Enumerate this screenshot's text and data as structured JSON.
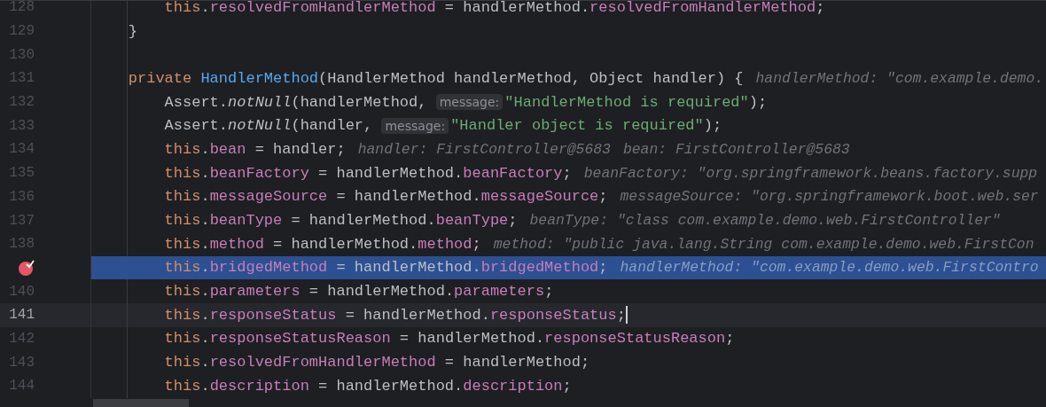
{
  "editor": {
    "lines": [
      {
        "number": "128",
        "current": false,
        "selected": false,
        "breakpoint": false,
        "caret": false,
        "tokens": [
          {
            "kind": "this",
            "text": "        this"
          },
          {
            "kind": "plain",
            "text": "."
          },
          {
            "kind": "field",
            "text": "resolvedFromHandlerMethod"
          },
          {
            "kind": "plain",
            "text": " = handlerMethod."
          },
          {
            "kind": "field",
            "text": "resolvedFromHandlerMethod"
          },
          {
            "kind": "plain",
            "text": ";"
          }
        ]
      },
      {
        "number": "129",
        "current": false,
        "selected": false,
        "breakpoint": false,
        "caret": false,
        "tokens": [
          {
            "kind": "plain",
            "text": "    }"
          }
        ]
      },
      {
        "number": "130",
        "current": false,
        "selected": false,
        "breakpoint": false,
        "caret": false
      },
      {
        "number": "131",
        "current": false,
        "selected": false,
        "breakpoint": false,
        "caret": false,
        "tokens": [
          {
            "kind": "keyword",
            "text": "    private "
          },
          {
            "kind": "declaration",
            "text": "HandlerMethod"
          },
          {
            "kind": "plain",
            "text": "(HandlerMethod handlerMethod, Object handler) {"
          },
          {
            "kind": "hint",
            "text": "handlerMethod: \"com.example.demo."
          }
        ]
      },
      {
        "number": "132",
        "current": false,
        "selected": false,
        "breakpoint": false,
        "caret": false,
        "tokens": [
          {
            "kind": "plain",
            "text": "        Assert."
          },
          {
            "kind": "static",
            "text": "notNull"
          },
          {
            "kind": "plain",
            "text": "(handlerMethod, "
          },
          {
            "kind": "inlay",
            "text": "message:"
          },
          {
            "kind": "string",
            "text": "\"HandlerMethod is required\""
          },
          {
            "kind": "plain",
            "text": ");"
          }
        ]
      },
      {
        "number": "133",
        "current": false,
        "selected": false,
        "breakpoint": false,
        "caret": false,
        "tokens": [
          {
            "kind": "plain",
            "text": "        Assert."
          },
          {
            "kind": "static",
            "text": "notNull"
          },
          {
            "kind": "plain",
            "text": "(handler, "
          },
          {
            "kind": "inlay",
            "text": "message:"
          },
          {
            "kind": "string",
            "text": "\"Handler object is required\""
          },
          {
            "kind": "plain",
            "text": ");"
          }
        ]
      },
      {
        "number": "134",
        "current": false,
        "selected": false,
        "breakpoint": false,
        "caret": false,
        "tokens": [
          {
            "kind": "this",
            "text": "        this"
          },
          {
            "kind": "plain",
            "text": "."
          },
          {
            "kind": "field",
            "text": "bean"
          },
          {
            "kind": "plain",
            "text": " = handler;"
          },
          {
            "kind": "hint",
            "text": "handler: FirstController@5683"
          },
          {
            "kind": "hint",
            "text": "bean: FirstController@5683"
          }
        ]
      },
      {
        "number": "135",
        "current": false,
        "selected": false,
        "breakpoint": false,
        "caret": false,
        "tokens": [
          {
            "kind": "this",
            "text": "        this"
          },
          {
            "kind": "plain",
            "text": "."
          },
          {
            "kind": "field",
            "text": "beanFactory"
          },
          {
            "kind": "plain",
            "text": " = handlerMethod."
          },
          {
            "kind": "field",
            "text": "beanFactory"
          },
          {
            "kind": "plain",
            "text": ";"
          },
          {
            "kind": "hint",
            "text": "beanFactory: \"org.springframework.beans.factory.supp"
          }
        ]
      },
      {
        "number": "136",
        "current": false,
        "selected": false,
        "breakpoint": false,
        "caret": false,
        "tokens": [
          {
            "kind": "this",
            "text": "        this"
          },
          {
            "kind": "plain",
            "text": "."
          },
          {
            "kind": "field",
            "text": "messageSource"
          },
          {
            "kind": "plain",
            "text": " = handlerMethod."
          },
          {
            "kind": "field",
            "text": "messageSource"
          },
          {
            "kind": "plain",
            "text": ";"
          },
          {
            "kind": "hint",
            "text": "messageSource: \"org.springframework.boot.web.ser"
          }
        ]
      },
      {
        "number": "137",
        "current": false,
        "selected": false,
        "breakpoint": false,
        "caret": false,
        "tokens": [
          {
            "kind": "this",
            "text": "        this"
          },
          {
            "kind": "plain",
            "text": "."
          },
          {
            "kind": "field",
            "text": "beanType"
          },
          {
            "kind": "plain",
            "text": " = handlerMethod."
          },
          {
            "kind": "field",
            "text": "beanType"
          },
          {
            "kind": "plain",
            "text": ";"
          },
          {
            "kind": "hint",
            "text": "beanType: \"class com.example.demo.web.FirstController\""
          }
        ]
      },
      {
        "number": "138",
        "current": false,
        "selected": false,
        "breakpoint": false,
        "caret": false,
        "tokens": [
          {
            "kind": "this",
            "text": "        this"
          },
          {
            "kind": "plain",
            "text": "."
          },
          {
            "kind": "field",
            "text": "method"
          },
          {
            "kind": "plain",
            "text": " = handlerMethod."
          },
          {
            "kind": "field",
            "text": "method"
          },
          {
            "kind": "plain",
            "text": ";"
          },
          {
            "kind": "hint",
            "text": "method: \"public java.lang.String com.example.demo.web.FirstCon"
          }
        ]
      },
      {
        "current": false,
        "selected": true,
        "breakpoint": true,
        "caret": false,
        "tokens": [
          {
            "kind": "this",
            "text": "        this"
          },
          {
            "kind": "plain",
            "text": "."
          },
          {
            "kind": "field",
            "text": "bridgedMethod"
          },
          {
            "kind": "plain",
            "text": " = handlerMethod."
          },
          {
            "kind": "field",
            "text": "bridgedMethod"
          },
          {
            "kind": "plain",
            "text": ";"
          },
          {
            "kind": "hint",
            "text": "handlerMethod: \"com.example.demo.web.FirstContro"
          }
        ]
      },
      {
        "number": "140",
        "current": false,
        "selected": false,
        "breakpoint": false,
        "caret": false,
        "tokens": [
          {
            "kind": "this",
            "text": "        this"
          },
          {
            "kind": "plain",
            "text": "."
          },
          {
            "kind": "field",
            "text": "parameters"
          },
          {
            "kind": "plain",
            "text": " = handlerMethod."
          },
          {
            "kind": "field",
            "text": "parameters"
          },
          {
            "kind": "plain",
            "text": ";"
          }
        ]
      },
      {
        "number": "141",
        "current": true,
        "selected": false,
        "breakpoint": false,
        "caret": true,
        "tokens": [
          {
            "kind": "this",
            "text": "        this"
          },
          {
            "kind": "plain",
            "text": "."
          },
          {
            "kind": "field",
            "text": "responseStatus"
          },
          {
            "kind": "plain",
            "text": " = handlerMethod."
          },
          {
            "kind": "field",
            "text": "responseStatus"
          },
          {
            "kind": "plain",
            "text": ";"
          }
        ]
      },
      {
        "number": "142",
        "current": false,
        "selected": false,
        "breakpoint": false,
        "caret": false,
        "tokens": [
          {
            "kind": "this",
            "text": "        this"
          },
          {
            "kind": "plain",
            "text": "."
          },
          {
            "kind": "field",
            "text": "responseStatusReason"
          },
          {
            "kind": "plain",
            "text": " = handlerMethod."
          },
          {
            "kind": "field",
            "text": "responseStatusReason"
          },
          {
            "kind": "plain",
            "text": ";"
          }
        ]
      },
      {
        "number": "143",
        "current": false,
        "selected": false,
        "breakpoint": false,
        "caret": false,
        "tokens": [
          {
            "kind": "this",
            "text": "        this"
          },
          {
            "kind": "plain",
            "text": "."
          },
          {
            "kind": "field",
            "text": "resolvedFromHandlerMethod"
          },
          {
            "kind": "plain",
            "text": " = handlerMethod;"
          }
        ]
      },
      {
        "number": "144",
        "current": false,
        "selected": false,
        "breakpoint": false,
        "caret": false,
        "tokens": [
          {
            "kind": "this",
            "text": "        this"
          },
          {
            "kind": "plain",
            "text": "."
          },
          {
            "kind": "field",
            "text": "description"
          },
          {
            "kind": "plain",
            "text": " = handlerMethod."
          },
          {
            "kind": "field",
            "text": "description"
          },
          {
            "kind": "plain",
            "text": ";"
          }
        ]
      }
    ]
  }
}
